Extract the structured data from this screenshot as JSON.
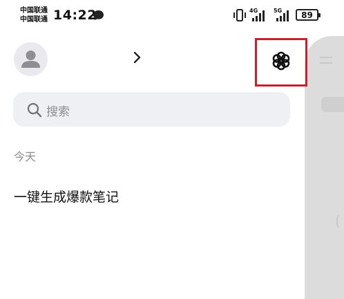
{
  "status_bar": {
    "carrier_1": "中国联通",
    "carrier_2": "中国联通",
    "time": "14:22",
    "network_1": "4G",
    "network_2": "5G",
    "battery": "89"
  },
  "search": {
    "placeholder": "搜索"
  },
  "history": {
    "section_label": "今天",
    "items": [
      "一键生成爆款笔记"
    ]
  },
  "icons": {
    "message": "message-bubble-icon",
    "vibrate": "vibrate-icon",
    "signal": "signal-icon",
    "profile_arrow": "chevron-right-icon",
    "settings": "flower-settings-icon",
    "search": "search-icon",
    "avatar": "user-avatar-icon"
  },
  "colors": {
    "highlight_box": "#cc1f2d",
    "search_bg": "#eef0f3",
    "panel_bg": "#dcdcdc"
  }
}
